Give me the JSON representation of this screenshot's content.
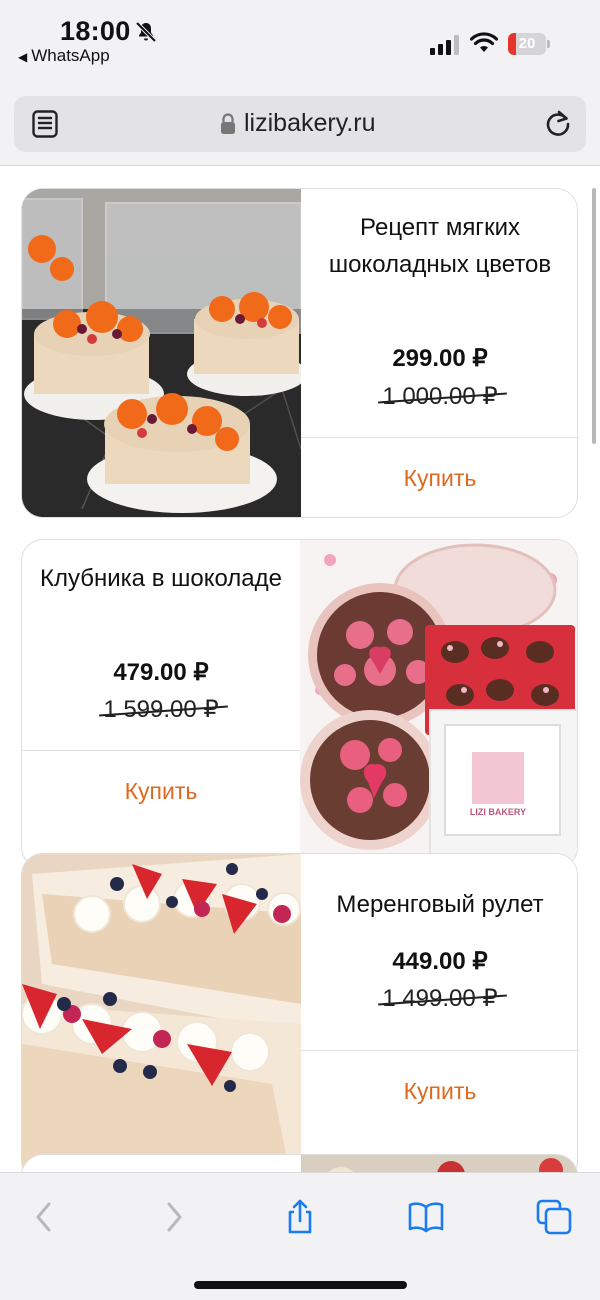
{
  "status_bar": {
    "time": "18:00",
    "back_app": "WhatsApp",
    "battery_level": 20,
    "battery_text": "20",
    "battery_color": "#e8352c"
  },
  "browser": {
    "url": "lizibakery.ru",
    "icons": [
      "reader-icon",
      "lock-icon",
      "reload-icon",
      "back-icon",
      "forward-icon",
      "share-icon",
      "bookmarks-icon",
      "tabs-icon"
    ]
  },
  "products": [
    {
      "title": "Рецепт мягких шоколадных цветов",
      "price": "299.00 ₽",
      "old_price": "1 000.00 ₽",
      "buy_label": "Купить"
    },
    {
      "title": "Клубника в шоколаде",
      "price": "479.00 ₽",
      "old_price": "1 599.00 ₽",
      "buy_label": "Купить",
      "photo_caption": "LIZI BAKERY"
    },
    {
      "title": "Меренговый рулет",
      "price": "449.00 ₽",
      "old_price": "1 499.00 ₽",
      "buy_label": "Купить"
    }
  ],
  "accent_color": "#e0691f"
}
